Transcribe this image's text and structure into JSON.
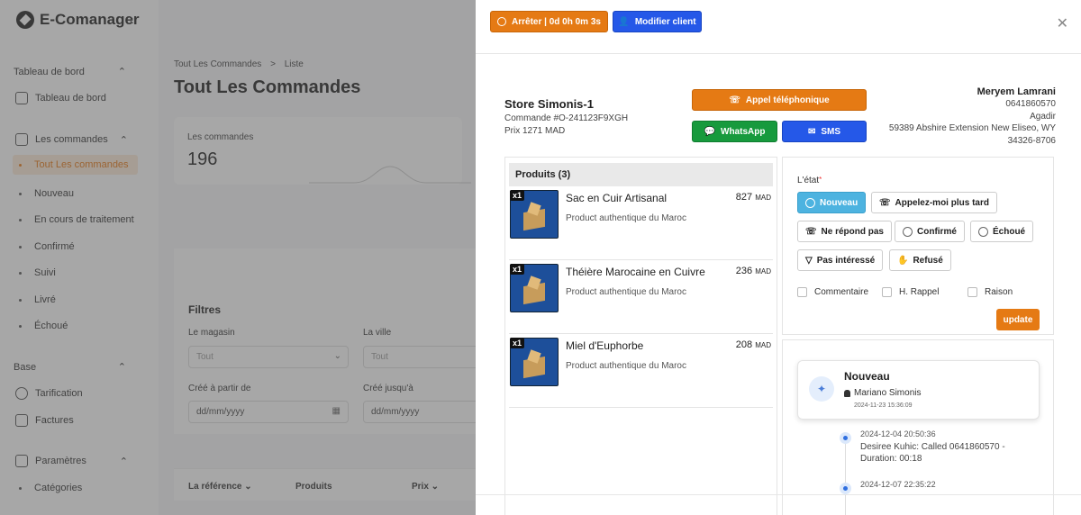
{
  "app": {
    "brand": "E-Comanager",
    "sidebar": {
      "sections": [
        {
          "label": "Tableau de bord"
        },
        {
          "label": "Base"
        },
        {
          "label": "Paramètres"
        }
      ],
      "dashboard": "Tableau de bord",
      "orders": "Les commandes",
      "orders_sub": [
        "Tout Les commandes",
        "Nouveau",
        "En cours de traitement",
        "Confirmé",
        "Suivi",
        "Livré",
        "Échoué"
      ],
      "pricing": "Tarification",
      "invoices": "Factures",
      "categories": "Catégories"
    },
    "main": {
      "breadcrumb_1": "Tout Les Commandes",
      "breadcrumb_sep": ">",
      "breadcrumb_2": "Liste",
      "title": "Tout Les Commandes",
      "stat_label": "Les commandes",
      "stat_value": "196",
      "filters_title": "Filtres",
      "store_label": "Le magasin",
      "store_value": "Tout",
      "city_label": "La ville",
      "city_value": "Tout",
      "from_label": "Créé à partir de",
      "from_placeholder": "dd/mm/yyyy",
      "to_label": "Créé jusqu'à",
      "to_placeholder": "dd/mm/yyyy",
      "col_ref": "La référence",
      "col_products": "Produits",
      "col_price": "Prix"
    }
  },
  "drawer": {
    "stop_button": "Arrêter | 0d 0h 0m 3s",
    "edit_client_button": "Modifier client",
    "store": "Store Simonis-1",
    "order_ref": "Commande #O-241123F9XGH",
    "price": "Prix 1271 MAD",
    "call_button": "Appel téléphonique",
    "whatsapp_button": "WhatsApp",
    "sms_button": "SMS",
    "customer": {
      "name": "Meryem Lamrani",
      "phone": "0641860570",
      "city": "Agadir",
      "address": "59389 Abshire Extension New Eliseo, WY",
      "zip": "34326-8706"
    },
    "products_title": "Produits (3)",
    "products": [
      {
        "qty": "x1",
        "name": "Sac en Cuir Artisanal",
        "price": "827",
        "currency": "MAD",
        "desc": "Product authentique du Maroc"
      },
      {
        "qty": "x1",
        "name": "Théière Marocaine en Cuivre",
        "price": "236",
        "currency": "MAD",
        "desc": "Product authentique du Maroc"
      },
      {
        "qty": "x1",
        "name": "Miel d'Euphorbe",
        "price": "208",
        "currency": "MAD",
        "desc": "Product authentique du Maroc"
      }
    ],
    "state_label": "L'état",
    "states": {
      "nouveau": "Nouveau",
      "callback": "Appelez-moi plus tard",
      "no_answer": "Ne répond pas",
      "confirmed": "Confirmé",
      "failed": "Échoué",
      "not_interested": "Pas intéressé",
      "refused": "Refusé"
    },
    "checkboxes": {
      "comment": "Commentaire",
      "reminder": "H. Rappel",
      "reason": "Raison"
    },
    "update_button": "update",
    "history": {
      "card_title": "Nouveau",
      "card_user": "Mariano Simonis",
      "card_date": "2024-11-23 15:36:09",
      "events": [
        {
          "date": "2024-12-04 20:50:36",
          "text": "Desiree Kuhic: Called 0641860570 - Duration: 00:18"
        },
        {
          "date": "2024-12-07 22:35:22",
          "text": ""
        }
      ]
    }
  },
  "colors": {
    "accent": "#e57a14",
    "primary": "#2558e8",
    "whatsapp": "#179a3d",
    "state_active": "#4db3e0"
  }
}
